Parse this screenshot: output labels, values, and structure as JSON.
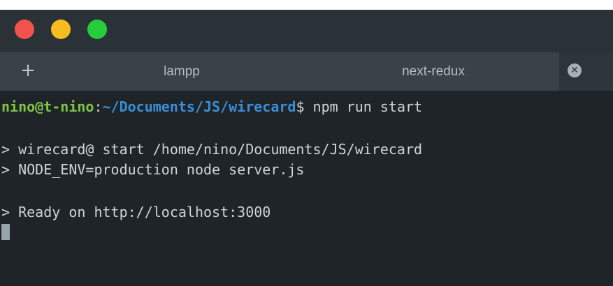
{
  "window": {
    "traffic_lights": [
      {
        "name": "close",
        "color": "#f0524c"
      },
      {
        "name": "minimize",
        "color": "#f7bc22"
      },
      {
        "name": "maximize",
        "color": "#26cc3c"
      }
    ]
  },
  "tabs": {
    "add_label": "+",
    "items": [
      {
        "label": "lampp"
      },
      {
        "label": "next-redux"
      }
    ],
    "close_icon": "x-circle-icon"
  },
  "terminal": {
    "prompt": {
      "user_host": "nino@t-nino",
      "separator": ":",
      "path": "~/Documents/JS/wirecard",
      "dollar": "$",
      "command": " npm run start"
    },
    "output": [
      "> wirecard@ start /home/nino/Documents/JS/wirecard",
      "> NODE_ENV=production node server.js",
      "> Ready on http://localhost:3000"
    ],
    "colors": {
      "user_host": "#7ec447",
      "path": "#3b8ed8",
      "text": "#d0d4d6",
      "background": "#1e2428"
    }
  }
}
